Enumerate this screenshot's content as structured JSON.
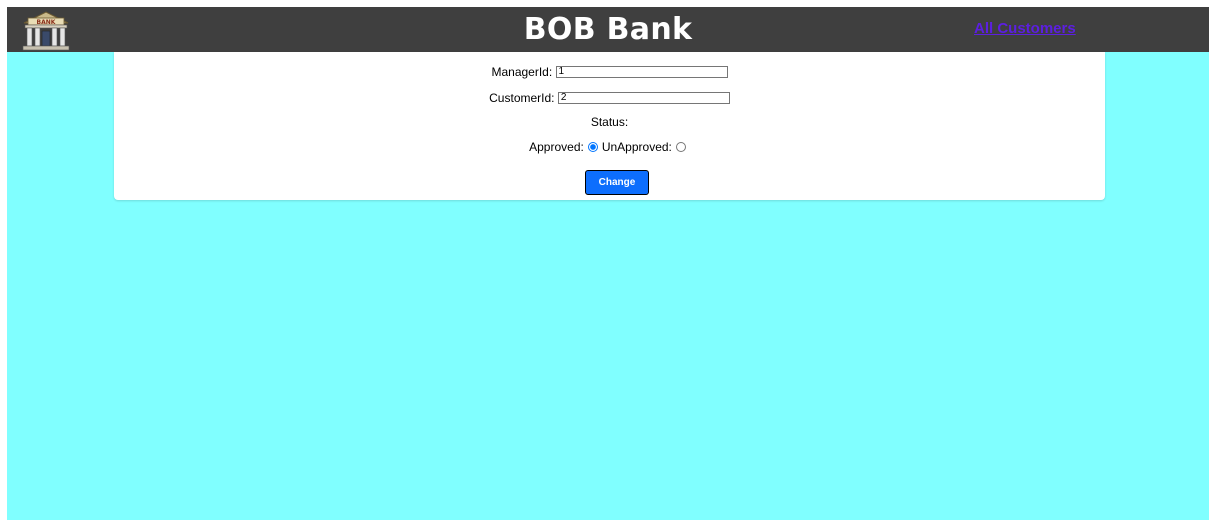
{
  "header": {
    "logo_text": "BANK",
    "brand": "BOB Bank",
    "nav_link": "All Customers"
  },
  "form": {
    "manager_label": "ManagerId:",
    "manager_value": "1",
    "customer_label": "CustomerId:",
    "customer_value": "2",
    "status_label": "Status:",
    "approved_label": "Approved:",
    "unapproved_label": "UnApproved:",
    "selected_status": "Approved",
    "submit_label": "Change"
  },
  "colors": {
    "page_background": "#80ffff",
    "navbar_background": "#3f3f3f",
    "nav_link": "#5c1fe0",
    "button": "#0d6efd"
  },
  "icons": {
    "logo": "bank-building-icon"
  }
}
